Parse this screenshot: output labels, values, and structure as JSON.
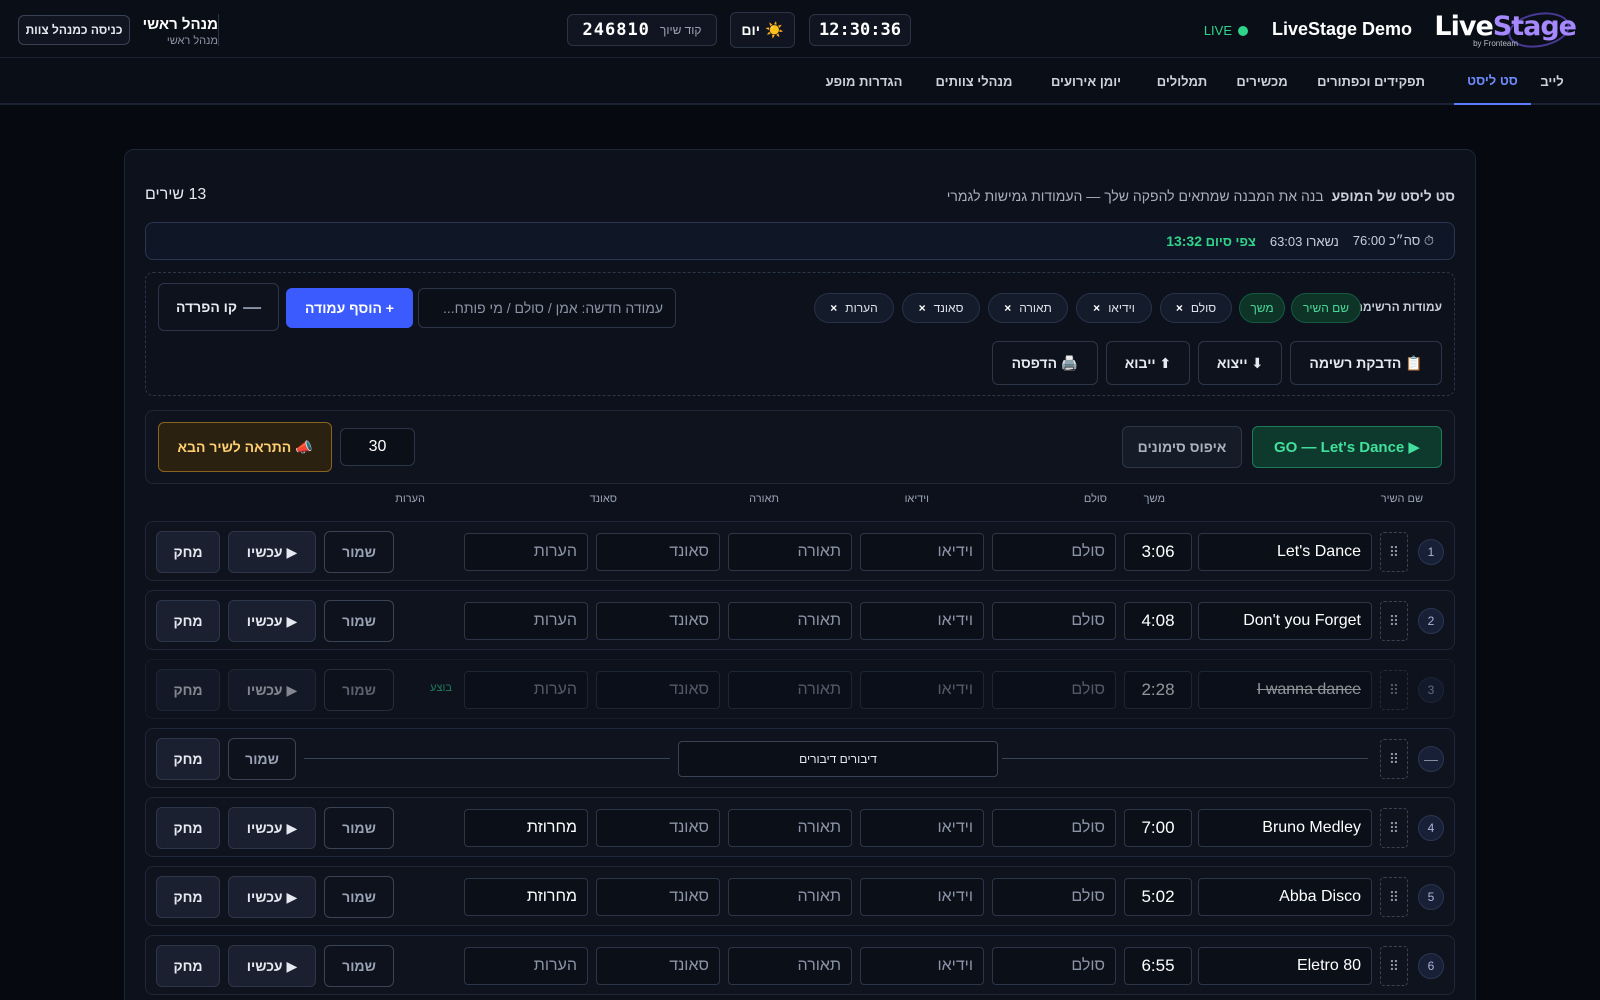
{
  "header": {
    "logo_main": "Live",
    "logo_accent": "Stage",
    "logo_sub": "by Fronteam",
    "brand_name": "LiveStage Demo",
    "live_label": "LIVE",
    "clock": "12:30:36",
    "day_mode_label": "יום",
    "day_mode_icon": "sun-icon",
    "link_code_label": "קוד שיוך",
    "link_code": "246810",
    "user_name": "מנהל ראשי",
    "user_role": "מנהל ראשי",
    "enter_as_manager": "כניסה כמנהל צוות"
  },
  "tabs": [
    {
      "label": "לייב",
      "active": false
    },
    {
      "label": "סט ליסט",
      "active": true
    },
    {
      "label": "תפקידים וכפתורים",
      "active": false
    },
    {
      "label": "מכשירים",
      "active": false
    },
    {
      "label": "תמלולים",
      "active": false
    },
    {
      "label": "יומן אירועים",
      "active": false
    },
    {
      "label": "מנהלי צוותים",
      "active": false
    },
    {
      "label": "הגדרות מופע",
      "active": false
    }
  ],
  "setlist": {
    "title": "סט ליסט של המופע",
    "subtitle": "בנה את המבנה שמתאים להפקה שלך — העמודות גמישות לגמרי",
    "song_count": "13 שירים",
    "timebar": {
      "total": "⏱ סה״כ 76:00",
      "remaining": "נשארו 63:03",
      "eta_label": "צפי סיום",
      "eta": "13:32"
    },
    "columns_label": "עמודות הרשימה:",
    "fixed_columns": [
      "שם השיר",
      "משך"
    ],
    "removable_columns": [
      "סולם",
      "וידיאו",
      "תאורה",
      "סאונד",
      "הערות"
    ],
    "remove_symbol": "×",
    "new_column_placeholder": "עמודה חדשה: אמן / סולם / מי פותח...",
    "add_column_button": "+ הוסף עמודה",
    "separator_button": "קו הפרדה",
    "separator_symbol": "—",
    "paste_list_button": "📋 הדבקת רשימה",
    "export_button": "⬇ ייצוא",
    "import_button": "⬆ ייבוא",
    "print_button": "🖨️ הדפסה",
    "go_button": "GO — Let's Dance ▶",
    "reset_marks_button": "איפוס סימונים",
    "alert_seconds": "30",
    "alert_next_button": "📣 התראה לשיר הבא",
    "column_headers": {
      "name": "שם השיר",
      "duration": "משך",
      "solo": "סולם",
      "video": "וידיאו",
      "light": "תאורה",
      "sound": "סאונד",
      "notes": "הערות"
    },
    "placeholders": {
      "solo": "סולם",
      "video": "וידיאו",
      "light": "תאורה",
      "sound": "סאונד",
      "notes": "הערות"
    },
    "row_buttons": {
      "save": "שמור",
      "now": "▶ עכשיו",
      "delete": "מחק",
      "performed": "בוצע",
      "drag": "⠿"
    },
    "rows": [
      {
        "type": "song",
        "num": "1",
        "name": "Let's Dance",
        "duration": "3:06",
        "notes": "",
        "performed": false
      },
      {
        "type": "song",
        "num": "2",
        "name": "Don't you Forget",
        "duration": "4:08",
        "notes": "",
        "performed": false
      },
      {
        "type": "song",
        "num": "3",
        "name": "I wanna dance",
        "duration": "2:28",
        "notes": "",
        "performed": true
      },
      {
        "type": "separator",
        "num": "—",
        "label": "דיבורים דיבורים"
      },
      {
        "type": "song",
        "num": "4",
        "name": "Bruno Medley",
        "duration": "7:00",
        "notes": "מחרוזת",
        "performed": false
      },
      {
        "type": "song",
        "num": "5",
        "name": "Abba Disco",
        "duration": "5:02",
        "notes": "מחרוזת",
        "performed": false
      },
      {
        "type": "song",
        "num": "6",
        "name": "Eletro 80",
        "duration": "6:55",
        "notes": "",
        "performed": false
      }
    ]
  }
}
